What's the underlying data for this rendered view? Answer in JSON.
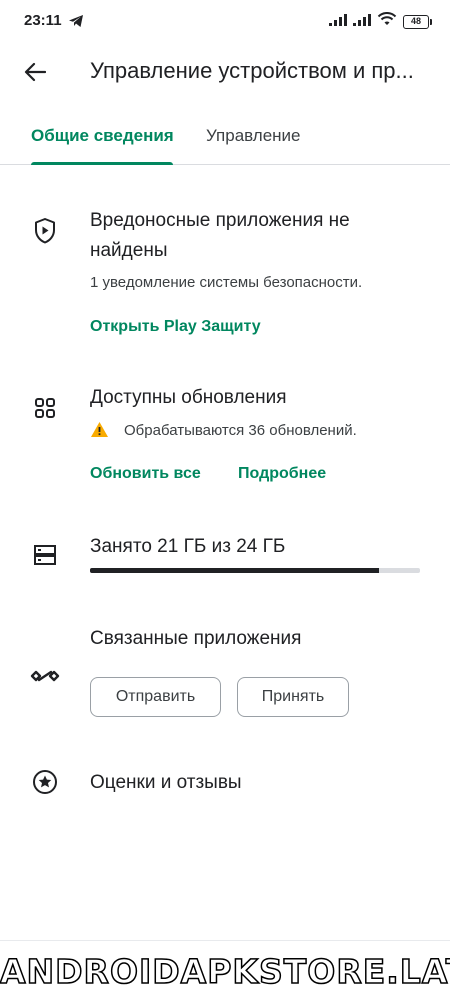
{
  "status_bar": {
    "time": "23:11",
    "battery": "48"
  },
  "app_bar": {
    "title": "Управление устройством и пр..."
  },
  "tabs": [
    {
      "label": "Общие сведения",
      "active": true
    },
    {
      "label": "Управление",
      "active": false
    }
  ],
  "protection": {
    "title": "Вредоносные приложения не найдены",
    "title_line1": "Вредоносные приложения не",
    "title_line2": "найдены",
    "subtitle": "1 уведомление системы безопасности.",
    "action": "Открыть Play Защиту"
  },
  "updates": {
    "title": "Доступны обновления",
    "status": "Обрабатываются 36 обновлений.",
    "update_all": "Обновить все",
    "details": "Подробнее"
  },
  "storage": {
    "label": "Занято 21 ГБ из 24 ГБ",
    "used_gb": 21,
    "total_gb": 24
  },
  "linked_apps": {
    "title": "Связанные приложения",
    "send": "Отправить",
    "receive": "Принять"
  },
  "ratings": {
    "title": "Оценки и отзывы"
  },
  "watermark": "ANDROIDAPKSTORE.LAT",
  "colors": {
    "accent": "#01875f",
    "warning": "#f9ab00",
    "text": "#202124"
  }
}
